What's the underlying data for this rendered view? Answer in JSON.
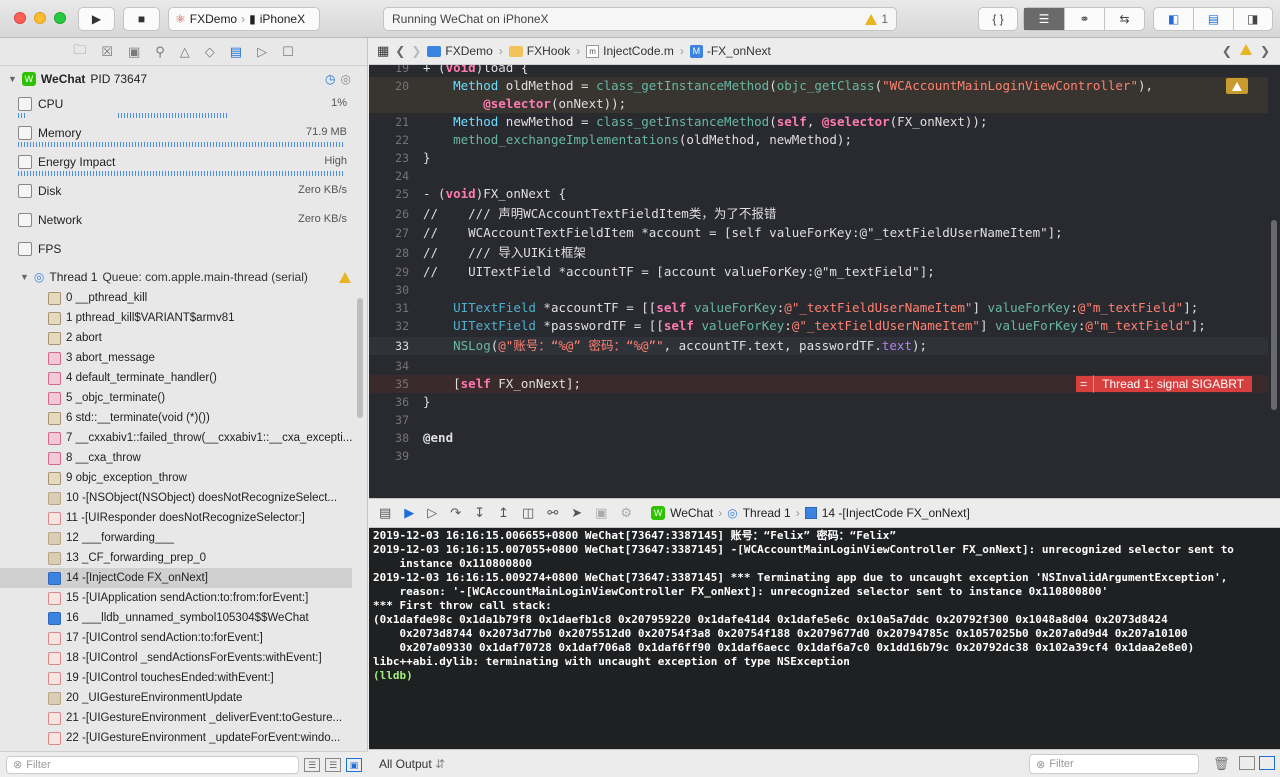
{
  "toolbar": {
    "scheme_project": "FXDemo",
    "scheme_device": "iPhoneX",
    "status_text": "Running WeChat on iPhoneX",
    "warning_count": "1"
  },
  "debug_nav": {
    "process_name": "WeChat",
    "process_pid": "PID 73647",
    "gauges": [
      {
        "label": "CPU",
        "value": "1%"
      },
      {
        "label": "Memory",
        "value": "71.9 MB"
      },
      {
        "label": "Energy Impact",
        "value": "High"
      },
      {
        "label": "Disk",
        "value": "Zero KB/s"
      },
      {
        "label": "Network",
        "value": "Zero KB/s"
      },
      {
        "label": "FPS",
        "value": ""
      }
    ],
    "thread_title": "Thread 1",
    "thread_queue": "Queue: com.apple.main-thread (serial)",
    "frames": [
      "0 __pthread_kill",
      "1 pthread_kill$VARIANT$armv81",
      "2 abort",
      "3 abort_message",
      "4 default_terminate_handler()",
      "5 _objc_terminate()",
      "6 std::__terminate(void (*)())",
      "7 __cxxabiv1::failed_throw(__cxxabiv1::__cxa_excepti...",
      "8 __cxa_throw",
      "9 objc_exception_throw",
      "10 -[NSObject(NSObject) doesNotRecognizeSelect...",
      "11 -[UIResponder doesNotRecognizeSelector:]",
      "12 ___forwarding___",
      "13 _CF_forwarding_prep_0",
      "14 -[InjectCode FX_onNext]",
      "15 -[UIApplication sendAction:to:from:forEvent:]",
      "16 ___lldb_unnamed_symbol105304$$WeChat",
      "17 -[UIControl sendAction:to:forEvent:]",
      "18 -[UIControl _sendActionsForEvents:withEvent:]",
      "19 -[UIControl touchesEnded:withEvent:]",
      "20 _UIGestureEnvironmentUpdate",
      "21 -[UIGestureEnvironment _deliverEvent:toGesture...",
      "22 -[UIGestureEnvironment _updateForEvent:windo..."
    ],
    "filter_placeholder": "Filter"
  },
  "jumpbar": {
    "items": [
      "FXDemo",
      "FXHook",
      "InjectCode.m",
      "-FX_onNext"
    ]
  },
  "editor": {
    "line_numbers": [
      "19",
      "20",
      "",
      "21",
      "22",
      "23",
      "24",
      "25",
      "26",
      "27",
      "28",
      "29",
      "30",
      "31",
      "32",
      "33",
      "34",
      "35",
      "36",
      "37",
      "38",
      "39"
    ],
    "error_text": "Thread 1: signal SIGABRT"
  },
  "debug_bar": {
    "process": "WeChat",
    "thread": "Thread 1",
    "frame": "14 -[InjectCode FX_onNext]"
  },
  "console": {
    "lines": [
      "2019-12-03 16:16:15.006655+0800 WeChat[73647:3387145] 账号：“Felix” 密码：“Felix”",
      "2019-12-03 16:16:15.007055+0800 WeChat[73647:3387145] -[WCAccountMainLoginViewController FX_onNext]: unrecognized selector sent to",
      "    instance 0x110800800",
      "2019-12-03 16:16:15.009274+0800 WeChat[73647:3387145] *** Terminating app due to uncaught exception 'NSInvalidArgumentException',",
      "    reason: '-[WCAccountMainLoginViewController FX_onNext]: unrecognized selector sent to instance 0x110800800'",
      "*** First throw call stack:",
      "(0x1dafde98c 0x1da1b79f8 0x1daefb1c8 0x207959220 0x1dafe41d4 0x1dafe5e6c 0x10a5a7ddc 0x20792f300 0x1048a8d04 0x2073d8424",
      "    0x2073d8744 0x2073d77b0 0x2075512d0 0x20754f3a8 0x20754f188 0x2079677d0 0x20794785c 0x1057025b0 0x207a0d9d4 0x207a10100",
      "    0x207a09330 0x1daf70728 0x1daf706a8 0x1daf6ff90 0x1daf6aecc 0x1daf6a7c0 0x1dd16b79c 0x20792dc38 0x102a39cf4 0x1daa2e8e0)",
      "libc++abi.dylib: terminating with uncaught exception of type NSException"
    ],
    "prompt": "(lldb)",
    "output_selector": "All Output",
    "filter_placeholder": "Filter"
  }
}
